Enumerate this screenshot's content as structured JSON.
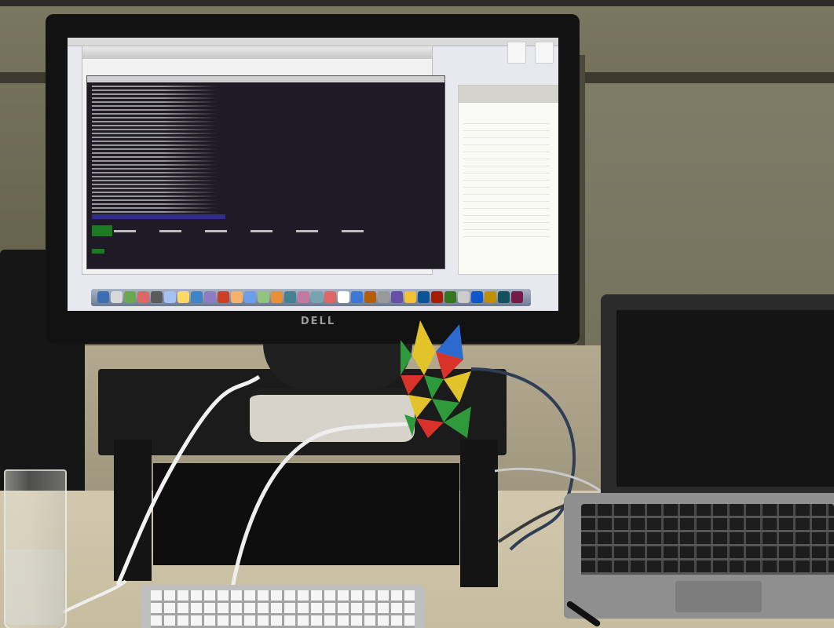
{
  "scene": {
    "monitor_brand": "DELL"
  },
  "screen": {
    "dock_icon_colors": [
      "#3b6fb0",
      "#d8d8d8",
      "#6aa84f",
      "#e06666",
      "#5b5b5b",
      "#a4c2f4",
      "#ffd966",
      "#3d85c6",
      "#8e7cc3",
      "#cc4125",
      "#f6b26b",
      "#6d9eeb",
      "#93c47d",
      "#e69138",
      "#45818e",
      "#c27ba0",
      "#76a5af",
      "#e06666",
      "#ffffff",
      "#3c78d8",
      "#b45f06",
      "#999999",
      "#674ea7",
      "#f1c232",
      "#0b5394",
      "#a61c00",
      "#38761d",
      "#cccccc",
      "#1155cc",
      "#bf9000",
      "#134f5c",
      "#741b47"
    ]
  },
  "puzzle": {
    "colors": [
      "#e3c32a",
      "#2d6ad0",
      "#d8322a",
      "#2f9a3b"
    ]
  }
}
